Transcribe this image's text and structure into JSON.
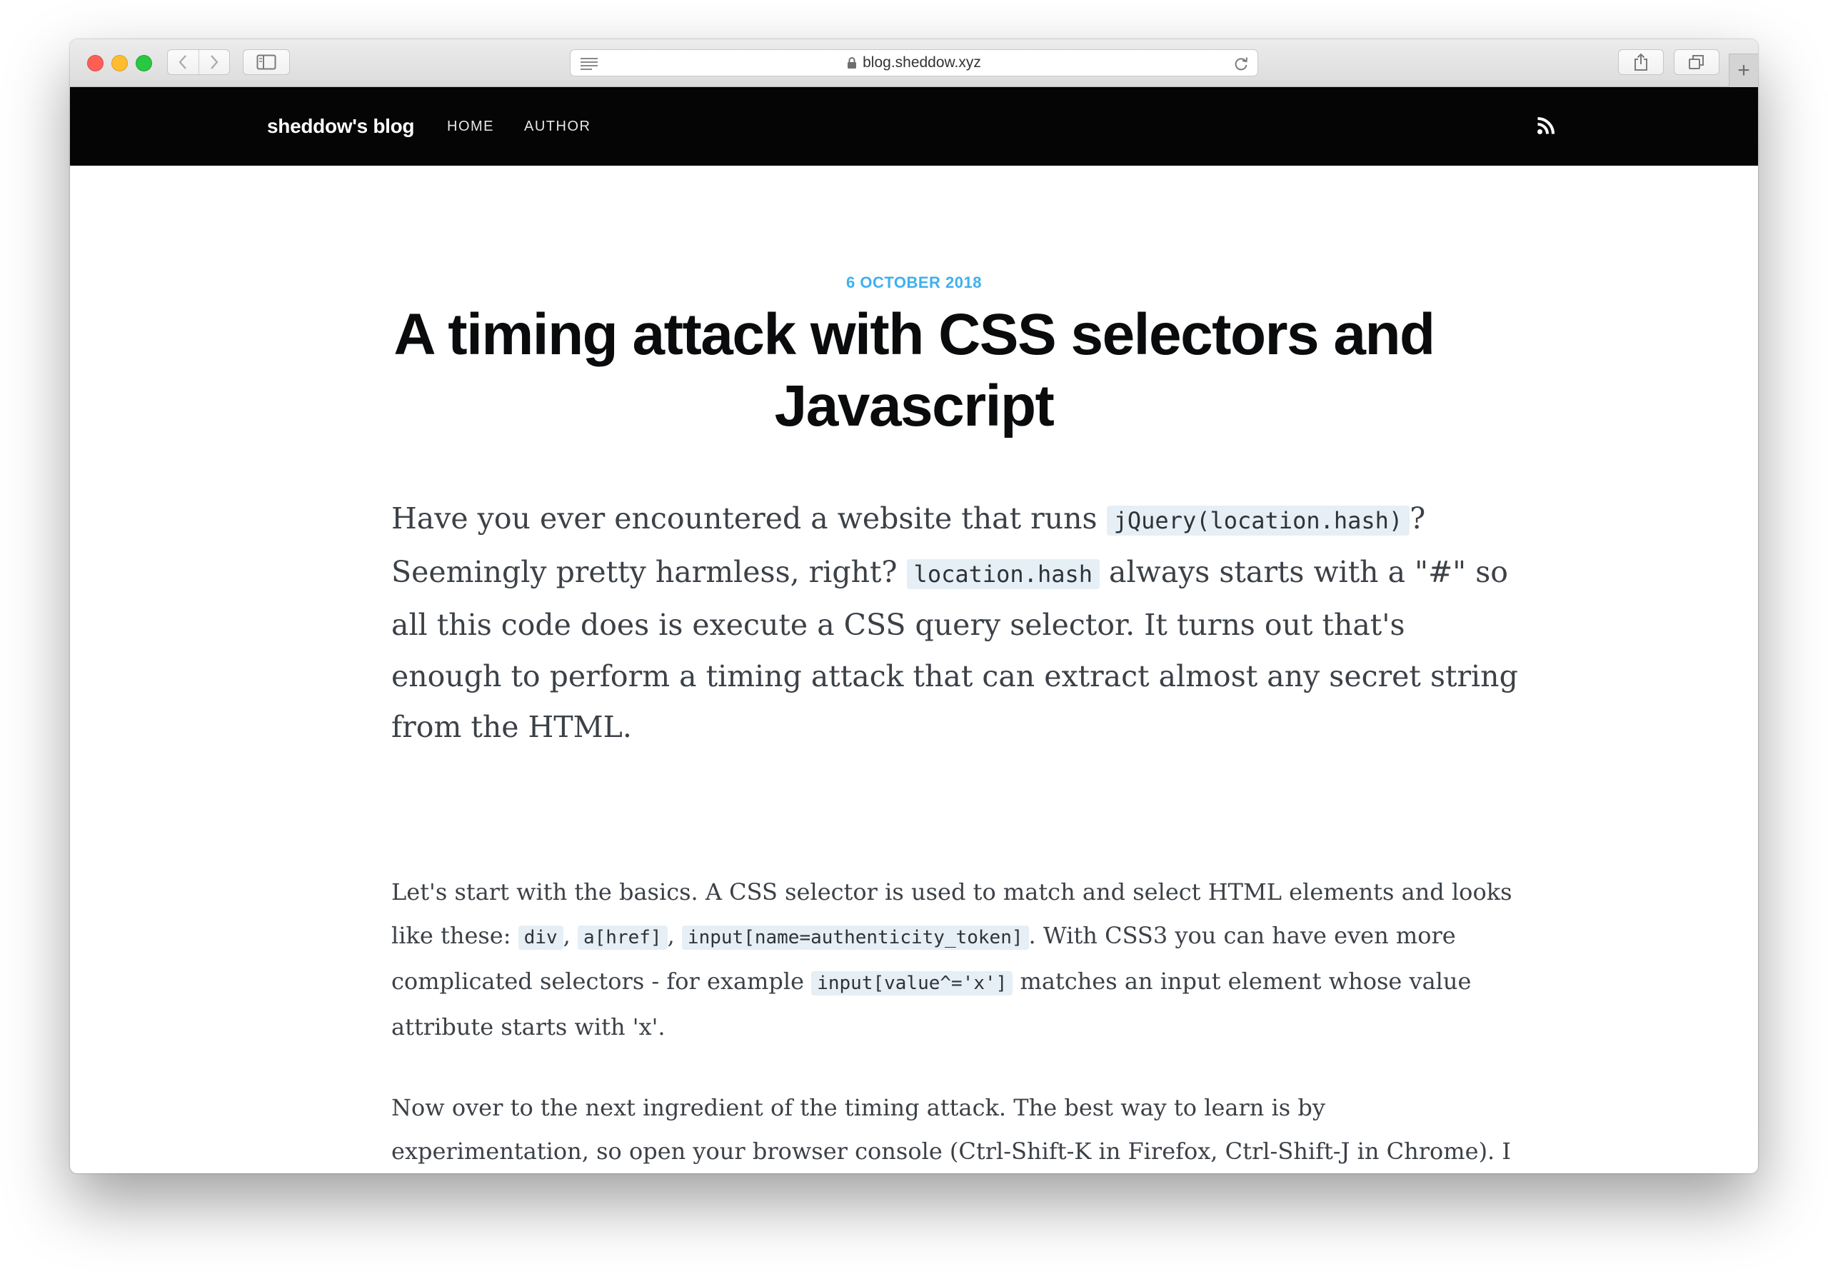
{
  "browser": {
    "url": "blog.sheddow.xyz",
    "new_tab_label": "+"
  },
  "site": {
    "brand": "sheddow's blog",
    "nav": {
      "home": "HOME",
      "author": "AUTHOR"
    }
  },
  "post": {
    "date": "6 OCTOBER 2018",
    "title": "A timing attack with CSS selectors and Javascript",
    "lead": {
      "t1": "Have you ever encountered a website that runs",
      "code1": "jQuery(location.hash)",
      "t2": "? Seemingly pretty harmless, right?",
      "code2": "location.hash",
      "t3": "always starts with a \"#\" so all this code does is execute a CSS query selector. It turns out that's enough to perform a timing attack that can extract almost any secret string from the HTML."
    },
    "p1": {
      "t1": "Let's start with the basics. A CSS selector is used to match and select HTML elements and looks like these:",
      "code1": "div",
      "sep1": ",",
      "code2": "a[href]",
      "sep2": ",",
      "code3": "input[name=authenticity_token]",
      "t2": ". With CSS3 you can have even more complicated selectors - for example",
      "code4": "input[value^='x']",
      "t3": "matches an input element whose value attribute starts with 'x'."
    },
    "p2": {
      "t1": "Now over to the next ingredient of the timing attack. The best way to learn is by experimentation, so open your browser console (Ctrl-Shift-K in Firefox, Ctrl-Shift-J in Chrome). I promise I won't trick you into self-XSS. Execute"
    }
  },
  "icons": {
    "traffic_close": "close-icon",
    "traffic_minimize": "minimize-icon",
    "traffic_zoom": "zoom-icon",
    "back": "chevron-left-icon",
    "forward": "chevron-right-icon",
    "sidebar": "sidebar-icon",
    "reader": "reader-icon",
    "lock": "lock-icon",
    "reload": "reload-icon",
    "share": "share-icon",
    "tabs": "tabs-icon",
    "rss": "rss-icon"
  },
  "colors": {
    "accent": "#3eb0ef",
    "header_bg": "#050505",
    "code_bg": "#e5eff5"
  }
}
